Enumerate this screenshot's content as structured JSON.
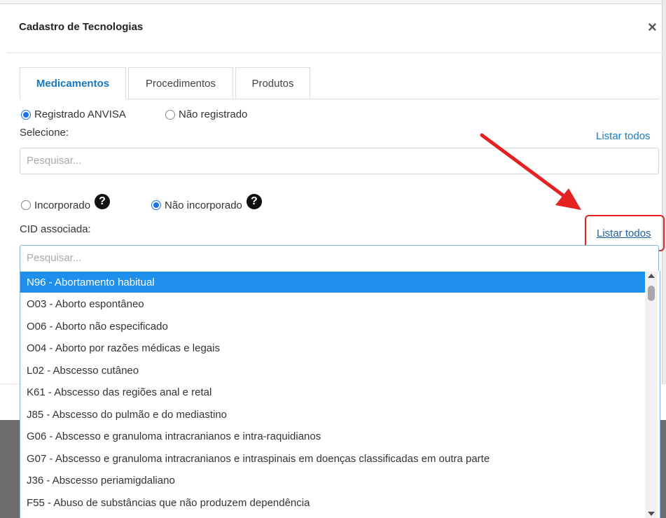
{
  "modal": {
    "title": "Cadastro de Tecnologias",
    "close_symbol": "×"
  },
  "tabs": [
    {
      "label": "Medicamentos",
      "active": true
    },
    {
      "label": "Procedimentos",
      "active": false
    },
    {
      "label": "Produtos",
      "active": false
    }
  ],
  "registration": {
    "options": [
      {
        "label": "Registrado ANVISA",
        "checked": true
      },
      {
        "label": "Não registrado",
        "checked": false
      }
    ],
    "select_label": "Selecione:",
    "list_all_label": "Listar todos",
    "search_placeholder": "Pesquisar..."
  },
  "incorporation": {
    "options": [
      {
        "label": "Incorporado",
        "checked": false
      },
      {
        "label": "Não incorporado",
        "checked": true
      }
    ],
    "help_symbol": "?"
  },
  "cid": {
    "label": "CID associada:",
    "list_all_label": "Listar todos",
    "search_placeholder": "Pesquisar...",
    "options": [
      "N96 - Abortamento habitual",
      "O03 - Aborto espontâneo",
      "O06 - Aborto não especificado",
      "O04 - Aborto por razões médicas e legais",
      "L02 - Abscesso cutâneo",
      "K61 - Abscesso das regiões anal e retal",
      "J85 - Abscesso do pulmão e do mediastino",
      "G06 - Abscesso e granuloma intracranianos e intra-raquidianos",
      "G07 - Abscesso e granuloma intracranianos e intraspinais em doenças classificadas em outra parte",
      "J36 - Abscesso periamigdaliano",
      "F55 - Abuso de substâncias que não produzem dependência"
    ],
    "selected_index": 0
  },
  "colors": {
    "accent": "#1a7dc2",
    "selected_option": "#1e8fea",
    "annotation_red": "#e52222",
    "backdrop": "#6e6e6e"
  },
  "icons": {
    "close": "close-icon",
    "help": "question-circle-icon",
    "arrow": "red-arrow-annotation",
    "scroll_up": "scroll-up-icon",
    "scroll_down": "scroll-down-icon"
  }
}
